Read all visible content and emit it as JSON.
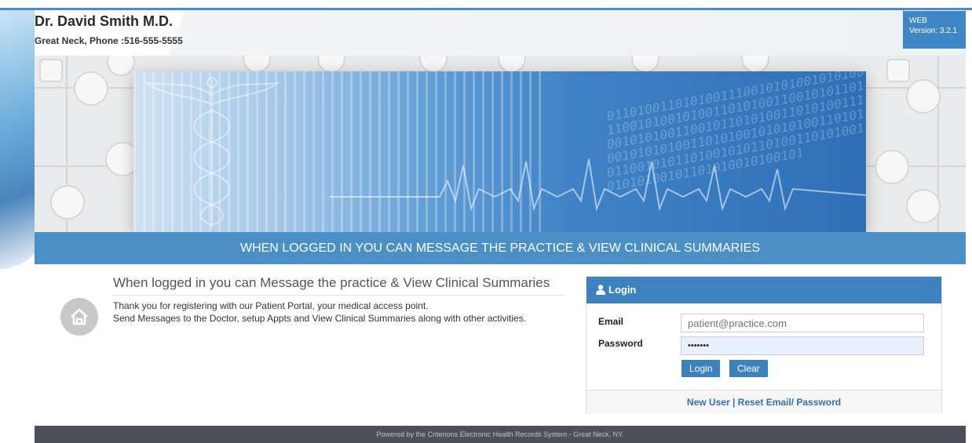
{
  "header": {
    "doctor_name": "Dr. David Smith M.D.",
    "subtitle": "Great Neck, Phone :516-555-5555",
    "version_line1": "WEB",
    "version_line2": "Version: 3.2.1"
  },
  "banner": {
    "binary_text": "0110100110101001110010101001010100110010100101001101010011001010110100101010011001011010100110101001110010101010011010100101010100110101011001010110100101011010011010100101010100101101010010100101"
  },
  "tagline": "WHEN LOGGED IN YOU CAN MESSAGE THE PRACTICE & VIEW CLINICAL SUMMARIES",
  "welcome": {
    "title": "When logged in you can Message the practice & View Clinical Summaries",
    "line1": "Thank you for registering with our Patient Portal, your medical access point.",
    "line2": "Send Messages to the Doctor, setup Appts and View Clinical Summaries along with other activities."
  },
  "login": {
    "heading": "Login",
    "email_label": "Email",
    "email_placeholder": "patient@practice.com",
    "password_label": "Password",
    "password_value": "•••••••",
    "login_button": "Login",
    "clear_button": "Clear",
    "new_user_link": "New User",
    "separator": "|",
    "reset_link": "Reset Email/ Password"
  },
  "footer": "Powered by the Criterions Electronic Health Records System - Great Neck, NY.",
  "colors": {
    "accent": "#3b82bf",
    "tagline_bg": "#4a8fc6",
    "footer_bg": "#4e5059"
  }
}
